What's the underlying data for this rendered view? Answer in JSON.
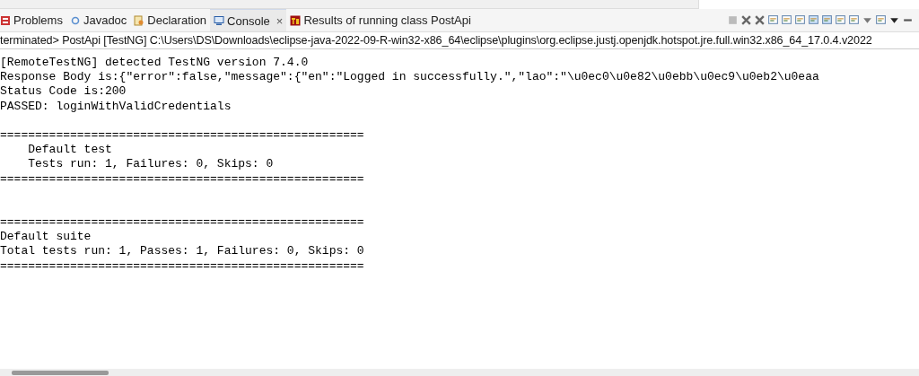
{
  "tabs": [
    {
      "label": "Problems",
      "kind": "problems",
      "selected": false
    },
    {
      "label": "Javadoc",
      "kind": "javadoc",
      "selected": false
    },
    {
      "label": "Declaration",
      "kind": "declaration",
      "selected": false
    },
    {
      "label": "Console",
      "kind": "console",
      "selected": true,
      "close": "×"
    },
    {
      "label": "Results of running class PostApi",
      "kind": "testng",
      "selected": false
    }
  ],
  "console": {
    "header": "terminated> PostApi [TestNG] C:\\Users\\DS\\Downloads\\eclipse-java-2022-09-R-win32-x86_64\\eclipse\\plugins\\org.eclipse.justj.openjdk.hotspot.jre.full.win32.x86_64_17.0.4.v2022",
    "lines": [
      "[RemoteTestNG] detected TestNG version 7.4.0",
      "Response Body is:{\"error\":false,\"message\":{\"en\":\"Logged in successfully.\",\"lao\":\"\\u0ec0\\u0e82\\u0ebb\\u0ec9\\u0eb2\\u0eaa",
      "Status Code is:200",
      "PASSED: loginWithValidCredentials",
      {
        "kind": "blank"
      },
      "====================================================",
      "    Default test",
      "    Tests run: 1, Failures: 0, Skips: 0",
      "====================================================",
      {
        "kind": "blank"
      },
      {
        "kind": "blank"
      },
      "====================================================",
      "Default suite",
      "Total tests run: 1, Passes: 1, Failures: 0, Skips: 0",
      "===================================================="
    ]
  }
}
